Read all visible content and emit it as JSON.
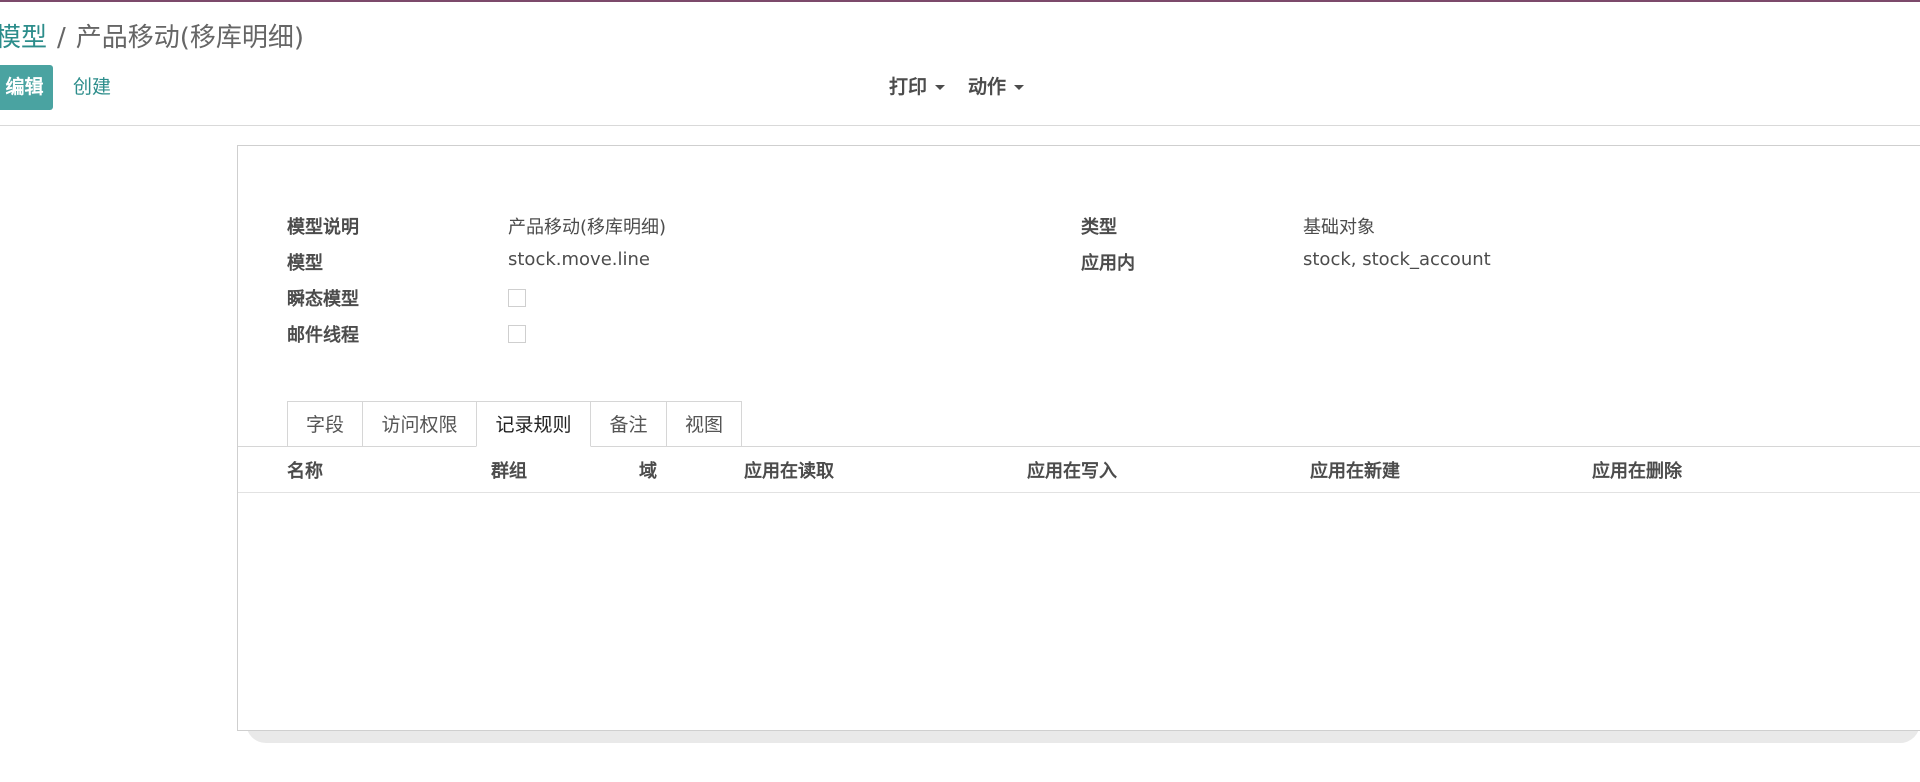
{
  "breadcrumb": {
    "parent": "模型",
    "separator": "/",
    "current": "产品移动(移库明细)"
  },
  "toolbar": {
    "edit_label": "编辑",
    "create_label": "创建",
    "print_label": "打印",
    "action_label": "动作"
  },
  "form": {
    "left": [
      {
        "label": "模型说明",
        "value": "产品移动(移库明细)"
      },
      {
        "label": "模型",
        "value": "stock.move.line"
      },
      {
        "label": "瞬态模型",
        "checked": false
      },
      {
        "label": "邮件线程",
        "checked": false
      }
    ],
    "right": [
      {
        "label": "类型",
        "value": "基础对象"
      },
      {
        "label": "应用内",
        "value": "stock, stock_account"
      }
    ]
  },
  "tabs": [
    {
      "label": "字段",
      "active": false
    },
    {
      "label": "访问权限",
      "active": false
    },
    {
      "label": "记录规则",
      "active": true
    },
    {
      "label": "备注",
      "active": false
    },
    {
      "label": "视图",
      "active": false
    }
  ],
  "table": {
    "columns": [
      "名称",
      "群组",
      "域",
      "应用在读取",
      "应用在写入",
      "应用在新建",
      "应用在删除"
    ],
    "rows": []
  },
  "colors": {
    "accent": "#4aa3a1",
    "link": "#2c8d8b",
    "top_bar": "#7c4a6b"
  }
}
